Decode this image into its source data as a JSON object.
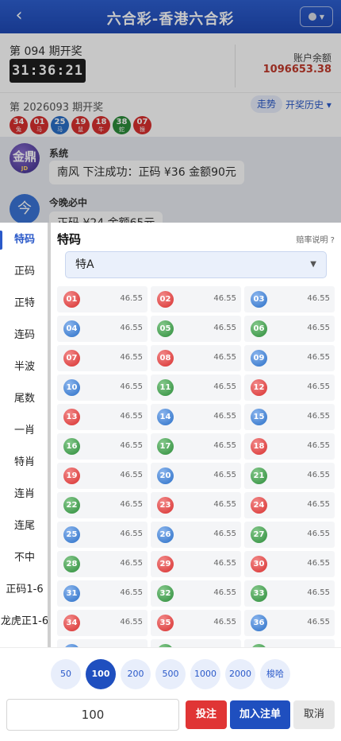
{
  "header": {
    "back_icon": "‹",
    "title": "六合彩-香港六合彩"
  },
  "draw": {
    "current_period": "第 094 期开奖",
    "countdown": "31:36:21",
    "balance_label": "账户余额",
    "balance_value": "1096653.38",
    "last_period": "第 2026093 期开奖",
    "trend_label": "走势",
    "history_label": "开奖历史 ▾",
    "results": [
      {
        "num": "34",
        "zodiac": "兔",
        "color": "#d8302f"
      },
      {
        "num": "01",
        "zodiac": "马",
        "color": "#d8302f"
      },
      {
        "num": "25",
        "zodiac": "马",
        "color": "#2a6fc7"
      },
      {
        "num": "19",
        "zodiac": "鼠",
        "color": "#d8302f"
      },
      {
        "num": "18",
        "zodiac": "牛",
        "color": "#d8302f"
      },
      {
        "num": "38",
        "zodiac": "蛇",
        "color": "#2c8c3a"
      },
      {
        "num": "07",
        "zodiac": "猴",
        "color": "#d8302f"
      }
    ]
  },
  "chat": {
    "msg1": {
      "avatar_text": "金鼎",
      "avatar_sub": "JD",
      "name": "系统",
      "text": "南风 下注成功：正码 ¥36 金额90元"
    },
    "msg2": {
      "avatar_text": "今",
      "name": "今晚必中",
      "text": "正码 ¥24 金额65元"
    }
  },
  "sidebar": [
    "特码",
    "正码",
    "正特",
    "连码",
    "半波",
    "尾数",
    "一肖",
    "特肖",
    "连肖",
    "连尾",
    "不中",
    "正码1-6",
    "龙虎正1-6"
  ],
  "sidebar_active": 0,
  "section": {
    "title": "特码",
    "odds_link": "赔率说明 ?",
    "select_value": "特A",
    "select_arrow": "▼"
  },
  "numbers": [
    {
      "n": "01",
      "c": "red"
    },
    {
      "n": "02",
      "c": "red"
    },
    {
      "n": "03",
      "c": "blue"
    },
    {
      "n": "04",
      "c": "blue"
    },
    {
      "n": "05",
      "c": "green"
    },
    {
      "n": "06",
      "c": "green"
    },
    {
      "n": "07",
      "c": "red"
    },
    {
      "n": "08",
      "c": "red"
    },
    {
      "n": "09",
      "c": "blue"
    },
    {
      "n": "10",
      "c": "blue"
    },
    {
      "n": "11",
      "c": "green"
    },
    {
      "n": "12",
      "c": "red"
    },
    {
      "n": "13",
      "c": "red"
    },
    {
      "n": "14",
      "c": "blue"
    },
    {
      "n": "15",
      "c": "blue"
    },
    {
      "n": "16",
      "c": "green"
    },
    {
      "n": "17",
      "c": "green"
    },
    {
      "n": "18",
      "c": "red"
    },
    {
      "n": "19",
      "c": "red"
    },
    {
      "n": "20",
      "c": "blue"
    },
    {
      "n": "21",
      "c": "green"
    },
    {
      "n": "22",
      "c": "green"
    },
    {
      "n": "23",
      "c": "red"
    },
    {
      "n": "24",
      "c": "red"
    },
    {
      "n": "25",
      "c": "blue"
    },
    {
      "n": "26",
      "c": "blue"
    },
    {
      "n": "27",
      "c": "green"
    },
    {
      "n": "28",
      "c": "green"
    },
    {
      "n": "29",
      "c": "red"
    },
    {
      "n": "30",
      "c": "red"
    },
    {
      "n": "31",
      "c": "blue"
    },
    {
      "n": "32",
      "c": "green"
    },
    {
      "n": "33",
      "c": "green"
    },
    {
      "n": "34",
      "c": "red"
    },
    {
      "n": "35",
      "c": "red"
    },
    {
      "n": "36",
      "c": "blue"
    },
    {
      "n": "",
      "c": "blue"
    },
    {
      "n": "",
      "c": "green"
    },
    {
      "n": "",
      "c": "green"
    }
  ],
  "odds_value": "46.55",
  "chips": [
    "50",
    "100",
    "200",
    "500",
    "1000",
    "2000",
    "梭哈"
  ],
  "chip_active": 1,
  "bet_amount": "100",
  "buttons": {
    "bet": "投注",
    "add": "加入注单",
    "cancel": "取消"
  }
}
